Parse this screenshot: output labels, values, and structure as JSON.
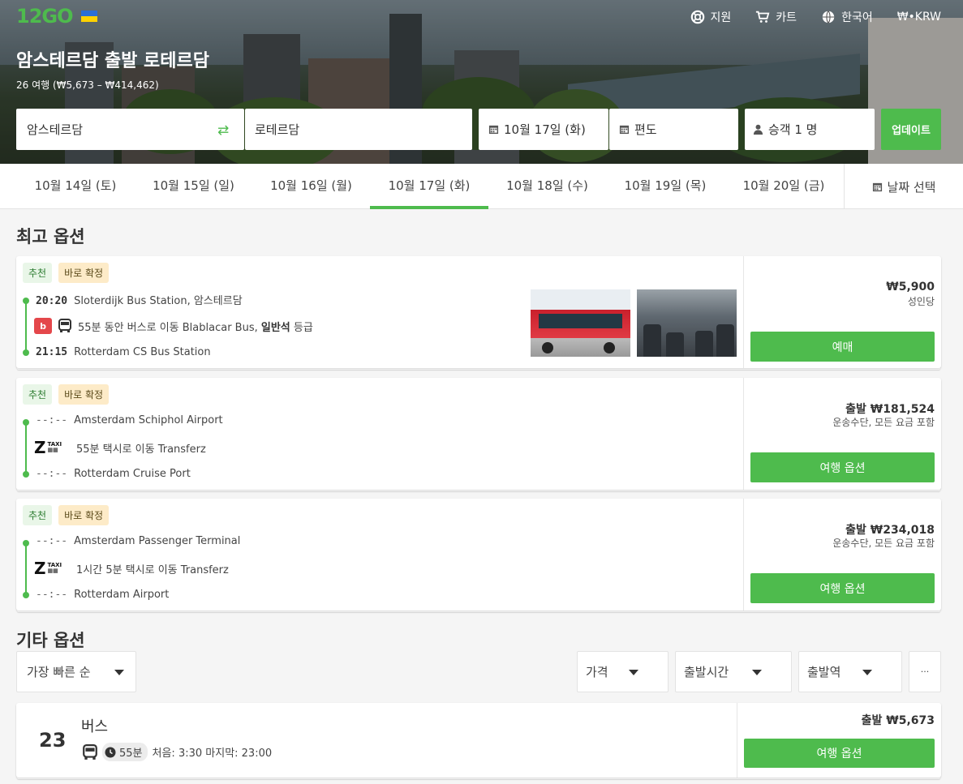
{
  "header": {
    "logo_text": "12GO",
    "nav": [
      {
        "icon": "lifebuoy-icon",
        "label": "지원"
      },
      {
        "icon": "cart-icon",
        "label": "카트"
      },
      {
        "icon": "globe-icon",
        "label": "한국어"
      },
      {
        "icon": "currency-icon",
        "label": "₩•KRW"
      }
    ]
  },
  "hero": {
    "title": "암스테르담 출발 로테르담",
    "subtitle": "26 여행 (₩5,673 – ₩414,462)"
  },
  "search": {
    "from": "암스테르담",
    "to": "로테르담",
    "date": "10월 17일 (화)",
    "return": "편도",
    "passengers": "승객 1 명",
    "update_label": "업데이트"
  },
  "date_tabs": [
    {
      "label": "10월 14일 (토)",
      "active": false
    },
    {
      "label": "10월 15일 (일)",
      "active": false
    },
    {
      "label": "10월 16일 (월)",
      "active": false
    },
    {
      "label": "10월 17일 (화)",
      "active": true
    },
    {
      "label": "10월 18일 (수)",
      "active": false
    },
    {
      "label": "10월 19일 (목)",
      "active": false
    },
    {
      "label": "10월 20일 (금)",
      "active": false
    }
  ],
  "date_select_label": "날짜 선택",
  "best_options_title": "최고 옵션",
  "best_options": [
    {
      "badges": [
        "추천",
        "바로 확정"
      ],
      "dep_time": "20:20",
      "dep_station": "Sloterdijk Bus Station, 암스테르담",
      "leg_text": "55분 동안 버스로 이동 Blablacar Bus,",
      "leg_class": "일반석",
      "leg_suffix": "등급",
      "arr_time": "21:15",
      "arr_station": "Rotterdam CS Bus Station",
      "price": "₩5,900",
      "price_note": "성인당",
      "button": "예매"
    },
    {
      "badges": [
        "추천",
        "바로 확정"
      ],
      "dep_time": "--:--",
      "dep_station": "Amsterdam Schiphol Airport",
      "leg_text": "55분 택시로 이동 Transferz",
      "arr_time": "--:--",
      "arr_station": "Rotterdam Cruise Port",
      "price": "출발 ₩181,524",
      "price_note": "운송수단, 모든 요금 포함",
      "button": "여행 옵션"
    },
    {
      "badges": [
        "추천",
        "바로 확정"
      ],
      "dep_time": "--:--",
      "dep_station": "Amsterdam Passenger Terminal",
      "leg_text": "1시간 5분 택시로 이동 Transferz",
      "arr_time": "--:--",
      "arr_station": "Rotterdam Airport",
      "price": "출발 ₩234,018",
      "price_note": "운송수단, 모든 요금 포함",
      "button": "여행 옵션"
    }
  ],
  "other_options_title": "기타 옵션",
  "filters": {
    "sort": "가장 빠른 순",
    "price": "가격",
    "departure_time": "출발시간",
    "departure_station": "출발역",
    "more": "···"
  },
  "groups": [
    {
      "count": "23",
      "title": "버스",
      "duration": "55분",
      "schedule": "처음: 3:30 마지막: 23:00",
      "price": "출발 ₩5,673",
      "button": "여행 옵션"
    }
  ],
  "colors": {
    "accent": "#4ebb4d",
    "badge_rec_bg": "#e9f6e8",
    "badge_confirm_bg": "#fdebc8"
  }
}
